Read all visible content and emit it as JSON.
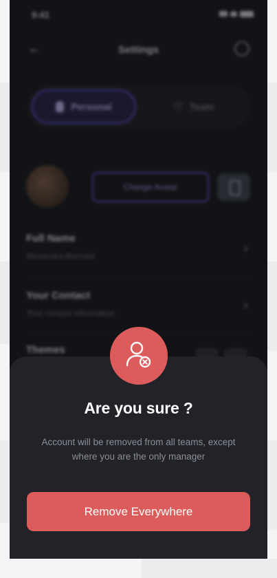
{
  "status_bar": {
    "time": "9:41"
  },
  "nav": {
    "title": "Settings"
  },
  "segments": [
    {
      "label": "Personal",
      "active": true
    },
    {
      "label": "Team",
      "active": false
    }
  ],
  "profile": {
    "change_avatar_label": "Change Avatar"
  },
  "settings": [
    {
      "title": "Full Name",
      "subtitle": "Alexandra Bernard"
    },
    {
      "title": "Your Contact",
      "subtitle": "Your contact information"
    },
    {
      "title": "Themes",
      "subtitle": ""
    }
  ],
  "dialog": {
    "title": "Are you sure ?",
    "message": "Account will be removed from all teams, except where you are the only manager",
    "confirm_label": "Remove Everywhere",
    "icon": "user-remove-icon",
    "accent_color": "#dc5b5b"
  }
}
